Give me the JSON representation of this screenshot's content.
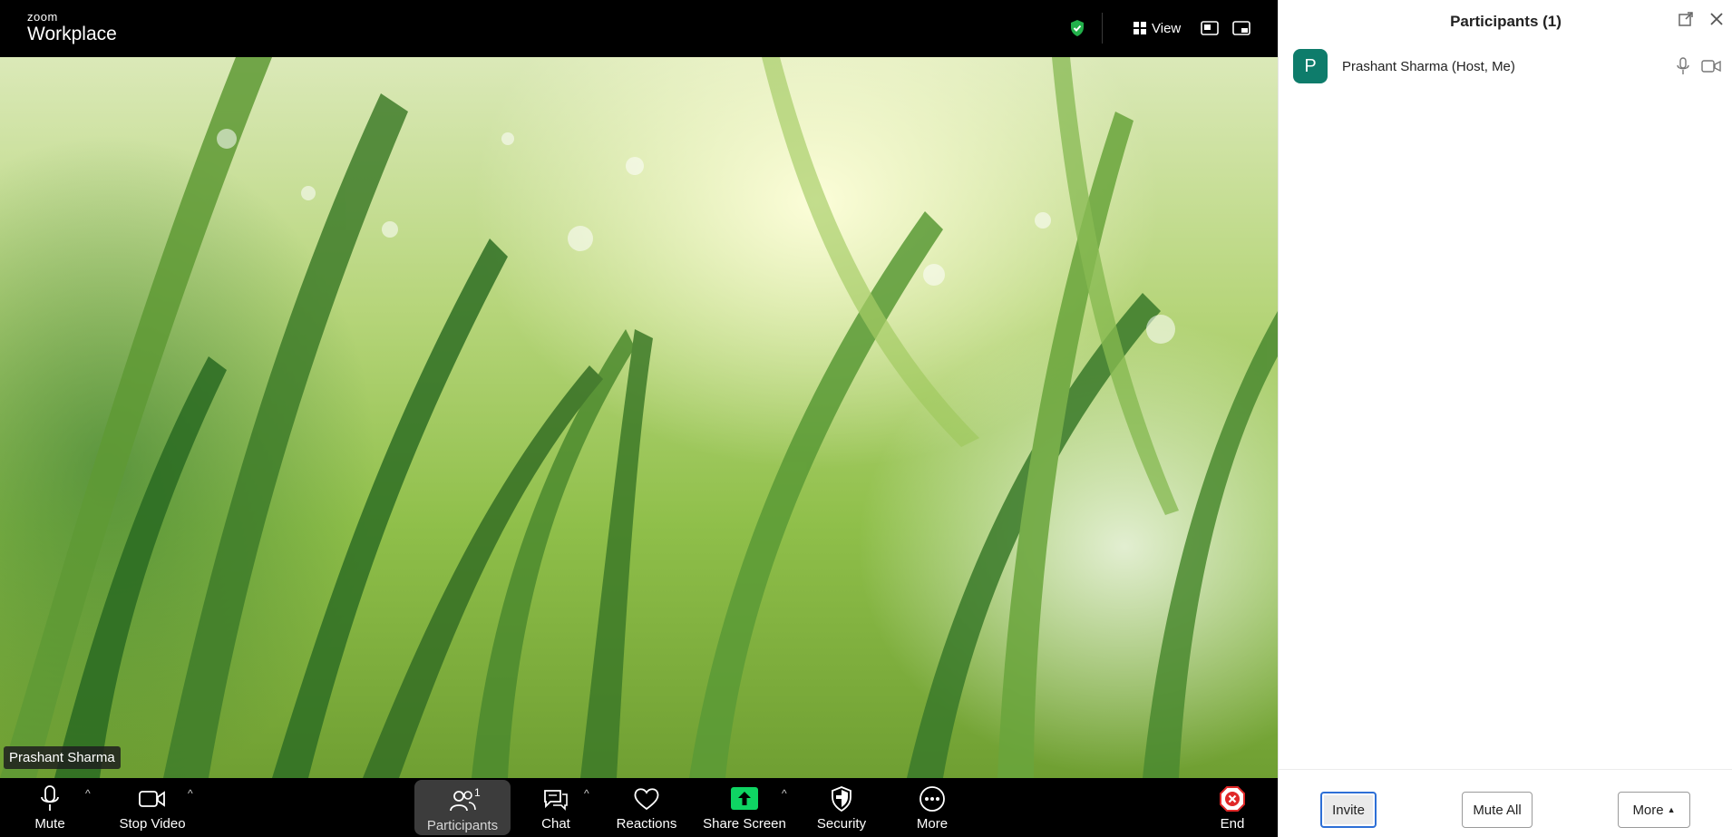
{
  "brand": {
    "line1": "zoom",
    "line2": "Workplace"
  },
  "topbar": {
    "view_label": "View"
  },
  "video": {
    "participant_name": "Prashant Sharma"
  },
  "toolbar": {
    "mute": "Mute",
    "stop_video": "Stop Video",
    "participants": "Participants",
    "participant_count": "1",
    "chat": "Chat",
    "reactions": "Reactions",
    "share_screen": "Share Screen",
    "security": "Security",
    "more": "More",
    "end": "End"
  },
  "panel": {
    "title": "Participants (1)",
    "participants": [
      {
        "initial": "P",
        "name": "Prashant Sharma (Host, Me)",
        "avatar_color": "#0e7c6b"
      }
    ],
    "invite": "Invite",
    "mute_all": "Mute All",
    "more": "More"
  },
  "colors": {
    "share_green": "#0fd463",
    "end_red": "#e02828",
    "shield_green": "#22b04a",
    "avatar": "#0e7c6b"
  }
}
